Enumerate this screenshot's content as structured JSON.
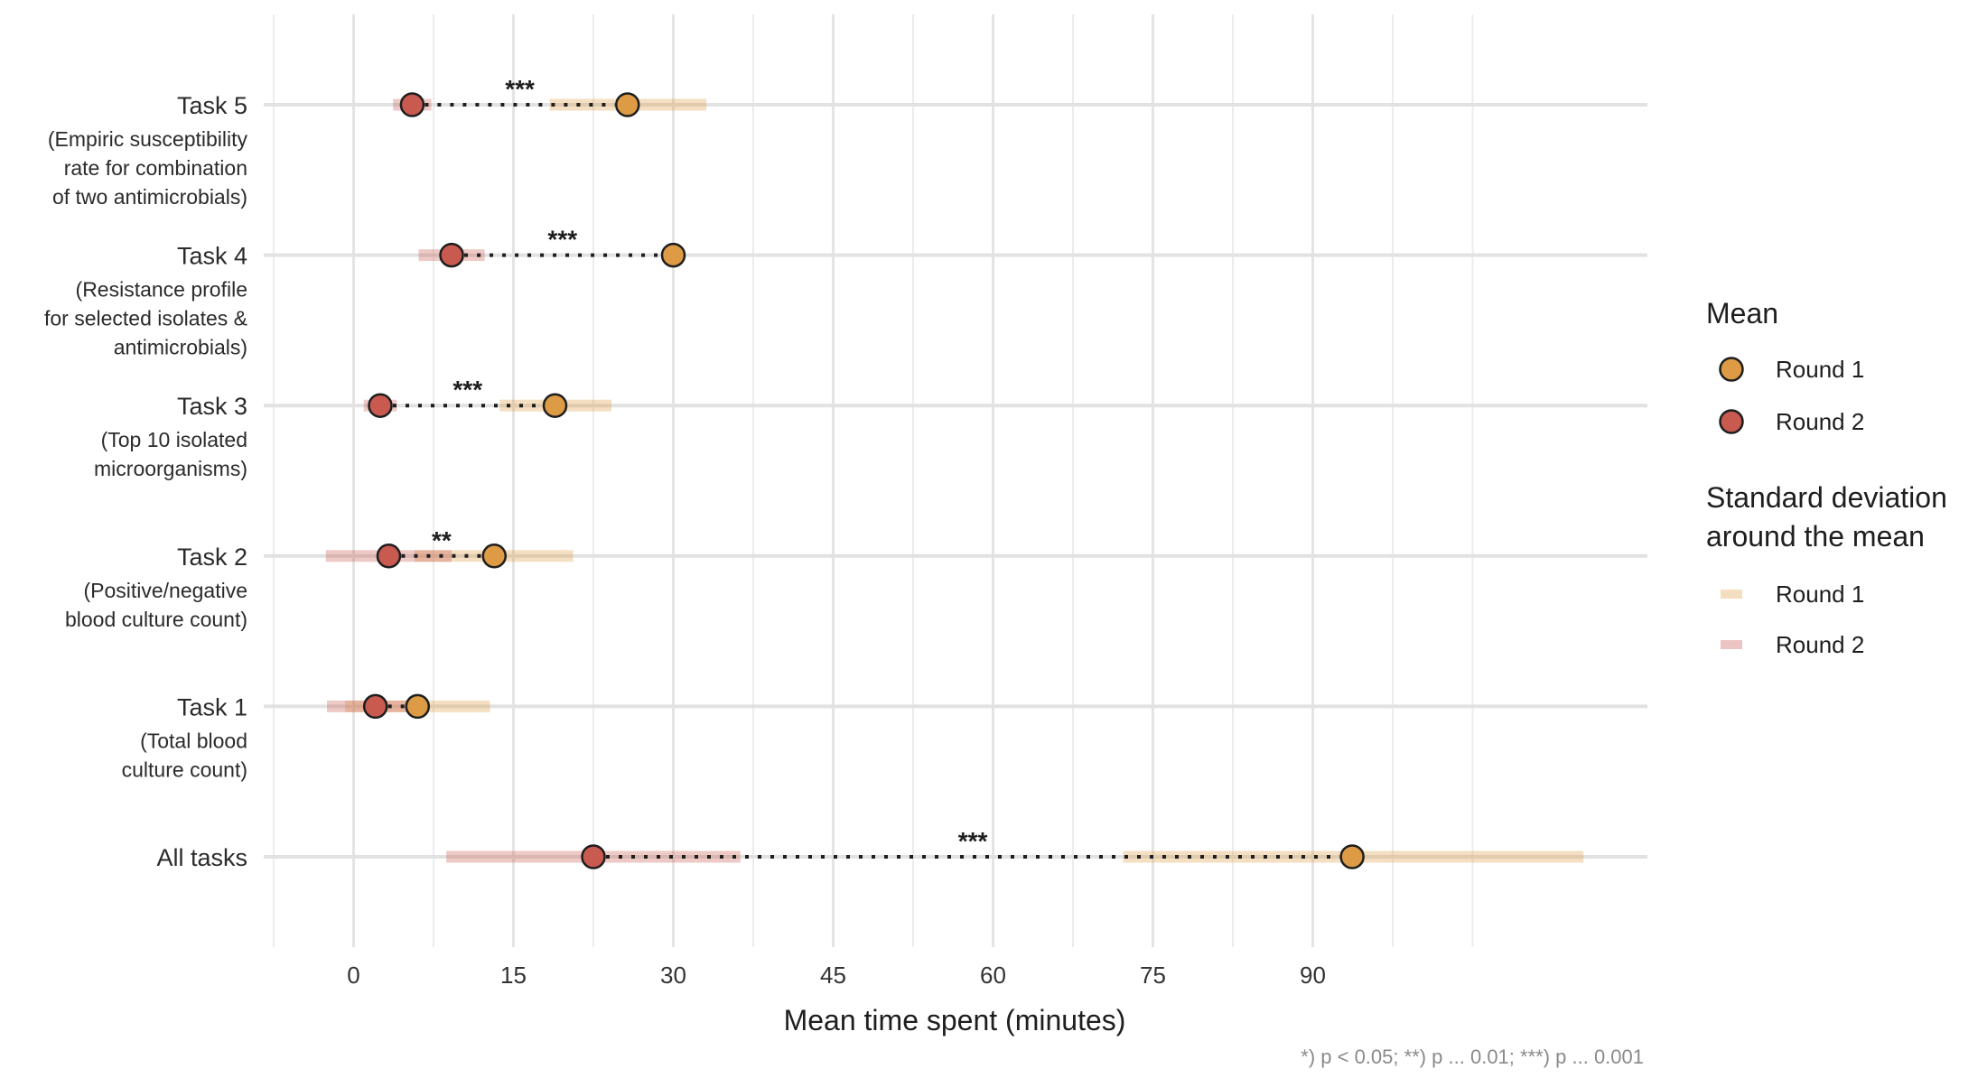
{
  "chart_data": {
    "type": "dumbbell",
    "title": "",
    "xlabel": "Mean time spent (minutes)",
    "ylabel": "",
    "xlim": [
      -8.4,
      121.4
    ],
    "x_ticks": [
      0,
      15,
      30,
      45,
      60,
      75,
      90
    ],
    "x_tick_labels": [
      "0",
      "15",
      "30",
      "45",
      "60",
      "75",
      "90"
    ],
    "x_minor_gridlines": [
      -7.5,
      7.5,
      22.5,
      37.5,
      52.5,
      67.5,
      82.5,
      97.5,
      105
    ],
    "grid": true,
    "caption": "*) p < 0.05; **) p ... 0.01; ***) p ... 0.001",
    "categories": [
      {
        "label": "Task 5",
        "sublabel": [
          "(Empiric susceptibility",
          "rate for combination",
          "of two antimicrobials)"
        ]
      },
      {
        "label": "Task 4",
        "sublabel": [
          "(Resistance profile",
          "for selected isolates &",
          "antimicrobials)"
        ]
      },
      {
        "label": "Task 3",
        "sublabel": [
          "(Top 10 isolated",
          "microorganisms)"
        ]
      },
      {
        "label": "Task 2",
        "sublabel": [
          "(Positive/negative",
          "blood culture count)"
        ]
      },
      {
        "label": "Task 1",
        "sublabel": [
          "(Total blood ",
          "culture count)"
        ]
      },
      {
        "label": "All tasks",
        "sublabel": []
      }
    ],
    "series": [
      {
        "name": "Round 1",
        "color": "#DD9B45",
        "sd_color": "#F3DFC0",
        "mean": [
          25.7,
          30.0,
          18.9,
          13.2,
          6.0,
          93.7
        ],
        "sd_low": [
          18.4,
          30.0,
          13.7,
          5.7,
          -0.8,
          72.2
        ],
        "sd_high": [
          33.1,
          30.0,
          24.2,
          20.6,
          12.8,
          115.4
        ]
      },
      {
        "name": "Round 2",
        "color": "#C95A50",
        "sd_color": "#EBC4C3",
        "mean": [
          5.5,
          9.2,
          2.5,
          3.3,
          2.05,
          22.5
        ],
        "sd_low": [
          3.7,
          6.1,
          0.95,
          -2.6,
          -2.5,
          8.7
        ],
        "sd_high": [
          7.3,
          12.3,
          4.05,
          9.2,
          6.6,
          36.3
        ]
      }
    ],
    "significance": [
      "***",
      "***",
      "***",
      "**",
      "",
      "***"
    ],
    "legend": {
      "placement": "right",
      "mean_title": "Mean",
      "sd_title": [
        "Standard deviation",
        "around the mean"
      ],
      "items": [
        "Round 1",
        "Round 2"
      ]
    }
  }
}
